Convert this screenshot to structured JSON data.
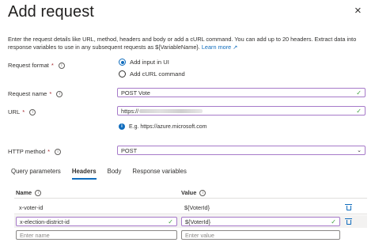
{
  "dialog": {
    "title": "Add request",
    "close_glyph": "×",
    "description": "Enter the request details like URL, method, headers and body or add a cURL command. You can add up to 20 headers. Extract data into response variables to use in any subsequent requests as ${VariableName}.",
    "learn_more": "Learn more",
    "learn_more_icon": "↗"
  },
  "form": {
    "request_format": {
      "label": "Request format",
      "required": "*",
      "options": [
        {
          "label": "Add input in UI",
          "selected": true
        },
        {
          "label": "Add cURL command",
          "selected": false
        }
      ]
    },
    "request_name": {
      "label": "Request name",
      "required": "*",
      "value": "POST Vote",
      "valid_icon": "✓"
    },
    "url": {
      "label": "URL",
      "required": "*",
      "value_prefix": "https://",
      "valid_icon": "✓",
      "hint": "E.g. https://azure.microsoft.com"
    },
    "http_method": {
      "label": "HTTP method",
      "required": "*",
      "value": "POST",
      "chevron": "⌄"
    }
  },
  "tabs": [
    {
      "label": "Query parameters",
      "active": false
    },
    {
      "label": "Headers",
      "active": true
    },
    {
      "label": "Body",
      "active": false
    },
    {
      "label": "Response variables",
      "active": false
    }
  ],
  "headers_table": {
    "name_header": "Name",
    "value_header": "Value",
    "rows": [
      {
        "name": "x-voter-id",
        "value": "${VoterId}"
      },
      {
        "name": "x-election-district-id",
        "value": "${VoterId}"
      }
    ],
    "name_placeholder": "Enter name",
    "value_placeholder": "Enter value",
    "valid_icon": "✓"
  },
  "colors": {
    "accent": "#0f6cbd",
    "focus_border": "#a67ac9",
    "valid": "#3b9e3b",
    "required": "#a4262c"
  }
}
